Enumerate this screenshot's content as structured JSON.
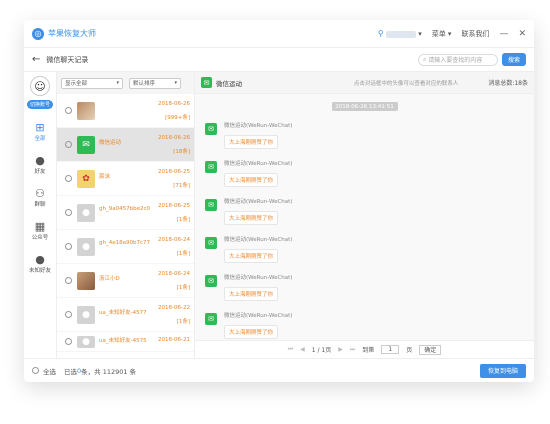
{
  "titlebar": {
    "app_name": "苹果恢复大师",
    "menu": "菜单",
    "contact": "联系我们",
    "minimize": "—",
    "close": "✕"
  },
  "subbar": {
    "title": "微信聊天记录",
    "search_placeholder": "请输入要查找的内容",
    "search_button": "搜索"
  },
  "sidebar": {
    "account_button": "切换账号",
    "items": [
      {
        "label": "全部",
        "icon": "grid-icon"
      },
      {
        "label": "好友",
        "icon": "person-icon"
      },
      {
        "label": "群聊",
        "icon": "group-icon"
      },
      {
        "label": "公众号",
        "icon": "apps-icon"
      },
      {
        "label": "未知好友",
        "icon": "unknown-person-icon"
      }
    ]
  },
  "list": {
    "filter_value": "显示全部",
    "sort_value": "默认排序",
    "rows": [
      {
        "name": "",
        "date": "2018-06-26",
        "count": "[999+条]"
      },
      {
        "name": "微信运动",
        "date": "2018-06-26",
        "count": "[18条]"
      },
      {
        "name": "宸沫",
        "date": "2018-06-25",
        "count": "[71条]"
      },
      {
        "name": "gh_9a0457bbe2c0",
        "date": "2018-06-25",
        "count": "[1条]"
      },
      {
        "name": "gh_4e18a90b7c77",
        "date": "2018-06-24",
        "count": "[1条]"
      },
      {
        "name": "浙江小D",
        "date": "2018-06-24",
        "count": "[1条]"
      },
      {
        "name": "ua_未知好友-4577",
        "date": "2018-06-22",
        "count": "[1条]"
      },
      {
        "name": "ua_未知好友-4575",
        "date": "2018-06-21",
        "count": ""
      }
    ]
  },
  "chat": {
    "title": "微信运动",
    "hint": "点击对话框中的头像可以查看对应的联系人",
    "total": "消息总数:18条",
    "date_pill": "2018-06-26 13:41:51",
    "messages": [
      {
        "sender": "微信运动(WeRun-WeChat)",
        "text": "大上海刚刚赞了你"
      },
      {
        "sender": "微信运动(WeRun-WeChat)",
        "text": "大上海刚刚赞了你"
      },
      {
        "sender": "微信运动(WeRun-WeChat)",
        "text": "大上海刚刚赞了你"
      },
      {
        "sender": "微信运动(WeRun-WeChat)",
        "text": "大上海刚刚赞了你"
      },
      {
        "sender": "微信运动(WeRun-WeChat)",
        "text": "大上海刚刚赞了你"
      },
      {
        "sender": "微信运动(WeRun-WeChat)",
        "text": "大上海刚刚赞了你"
      }
    ],
    "pager": {
      "page_info": "1 / 1页",
      "goto_label": "到第",
      "page_value": "1",
      "page_unit": "页",
      "ok": "确定"
    }
  },
  "footer": {
    "select_all": "全选",
    "selected_prefix": "已选",
    "selected_count": "0",
    "selected_suffix": "条，共 112901 条",
    "recover_button": "恢复到电脑"
  }
}
